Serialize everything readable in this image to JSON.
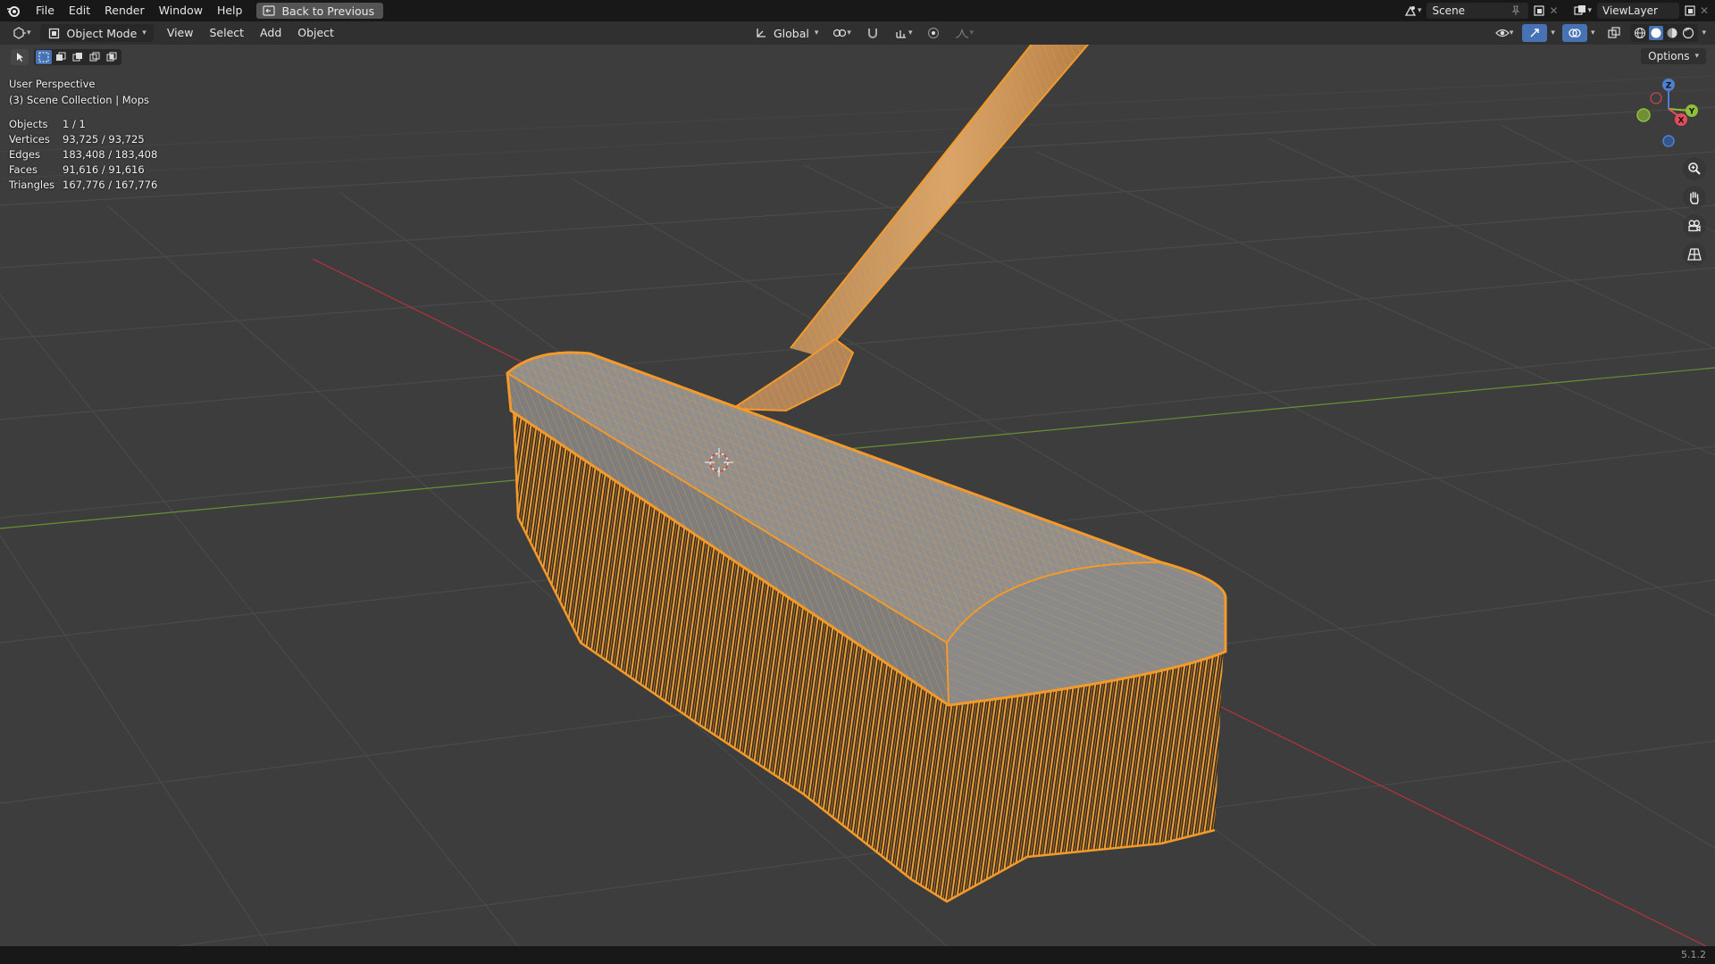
{
  "topbar": {
    "menus": [
      "File",
      "Edit",
      "Render",
      "Window",
      "Help"
    ],
    "back_label": "Back to Previous",
    "scene_name": "Scene",
    "view_layer": "ViewLayer"
  },
  "header": {
    "mode": "Object Mode",
    "menus": [
      "View",
      "Select",
      "Add",
      "Object"
    ],
    "transform_orientation": "Global"
  },
  "tool_settings": {
    "options_label": "Options"
  },
  "overlay": {
    "view_name": "User Perspective",
    "collection": "(3) Scene Collection | Mops",
    "stats": [
      {
        "label": "Objects",
        "value": "1 / 1"
      },
      {
        "label": "Vertices",
        "value": "93,725 / 93,725"
      },
      {
        "label": "Edges",
        "value": "183,408 / 183,408"
      },
      {
        "label": "Faces",
        "value": "91,616 / 91,616"
      },
      {
        "label": "Triangles",
        "value": "167,776 / 167,776"
      }
    ]
  },
  "gizmo": {
    "z_label": "Z",
    "y_label": "Y",
    "x_label": "X"
  },
  "statusbar": {
    "version": "5.1.2"
  },
  "colors": {
    "selection_orange": "#f39a2a",
    "mesh_gray": "#8e8e8e",
    "axis_x": "#c8323c",
    "axis_y": "#6c9a2f",
    "active_blue": "#4772b3"
  }
}
